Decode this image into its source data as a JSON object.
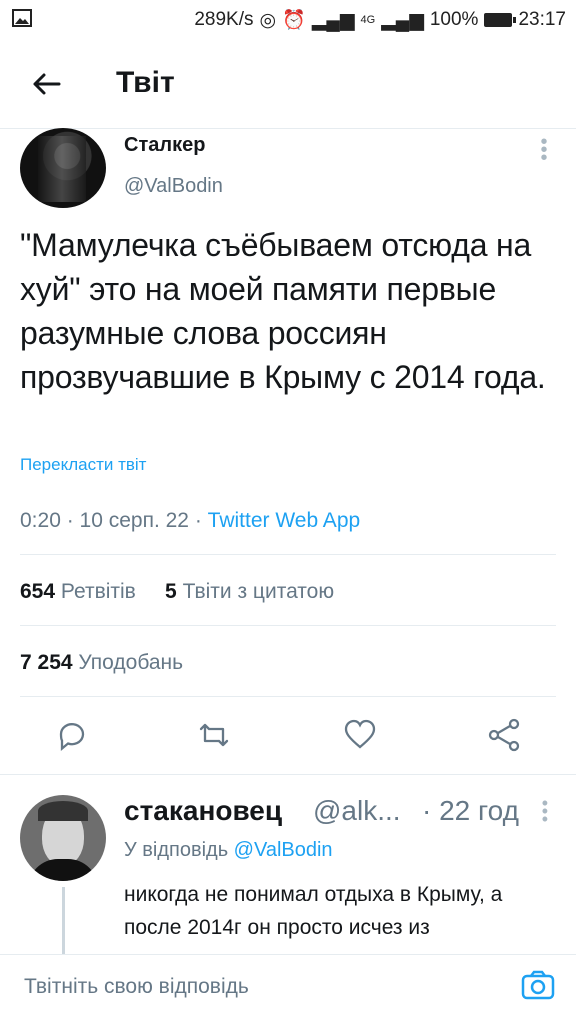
{
  "status": {
    "network": "289K/s",
    "signal": "4G",
    "battery": "100%",
    "time": "23:17"
  },
  "header": {
    "title": "Твіт"
  },
  "tweet": {
    "author": "Сталкер",
    "handle": "@ValBodin",
    "text": "\"Мамулечка съёбываем отсюда на хуй\" это на моей памяти первые разумные слова россиян прозвучавшие в Крыму с 2014 года.",
    "translate": "Перекласти твіт",
    "time": "0:20 · 10 серп. 22 · ",
    "source": "Twitter Web App",
    "retweets_count": "654",
    "retweets_label": "Ретвітів",
    "quotes_count": "5",
    "quotes_label": "Твіти з цитатою",
    "likes_count": "7 254",
    "likes_label": "Уподобань"
  },
  "reply": {
    "name": "стакановец",
    "handle": "@alk...",
    "time": "· 22 год",
    "replying_to_prefix": "У відповідь ",
    "replying_to": "@ValBodin",
    "text": "никогда не понимал отдыха в Крыму, а после 2014г он просто исчез из"
  },
  "composer": {
    "placeholder": "Твітніть свою відповідь"
  },
  "colors": {
    "accent": "#1da1f2",
    "muted": "#657786",
    "divider": "#e6ecf0"
  }
}
